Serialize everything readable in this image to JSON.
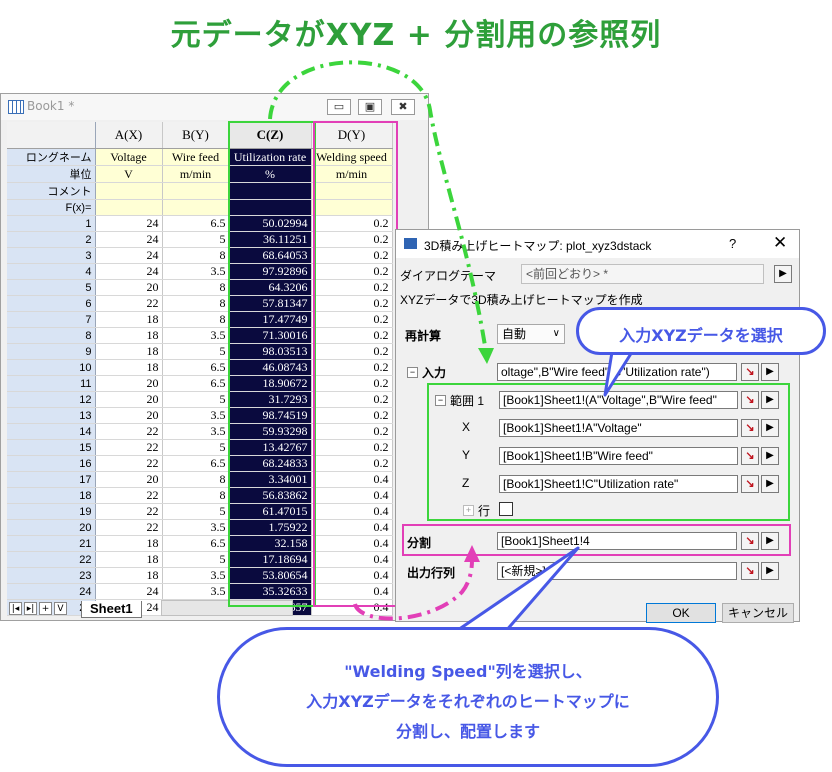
{
  "headline": "元データがXYZ + 分割用の参照列",
  "book": {
    "title": "Book1 *",
    "win_min": "▭",
    "win_max": "▣",
    "win_close": "✖",
    "corner": "",
    "columns": [
      "A(X)",
      "B(Y)",
      "C(Z)",
      "D(Y)"
    ],
    "meta_rows": [
      {
        "label": "ロングネーム",
        "cells": [
          "Voltage",
          "Wire feed",
          "Utilization rate",
          "Welding speed"
        ]
      },
      {
        "label": "単位",
        "cells": [
          "V",
          "m/min",
          "%",
          "m/min"
        ]
      },
      {
        "label": "コメント",
        "cells": [
          "",
          "",
          "",
          ""
        ]
      },
      {
        "label": "F(x)=",
        "cells": [
          "",
          "",
          "",
          ""
        ]
      }
    ],
    "rows": [
      {
        "n": "1",
        "a": "24",
        "b": "6.5",
        "c": "50.02994",
        "d": "0.2"
      },
      {
        "n": "2",
        "a": "24",
        "b": "5",
        "c": "36.11251",
        "d": "0.2"
      },
      {
        "n": "3",
        "a": "24",
        "b": "8",
        "c": "68.64053",
        "d": "0.2"
      },
      {
        "n": "4",
        "a": "24",
        "b": "3.5",
        "c": "97.92896",
        "d": "0.2"
      },
      {
        "n": "5",
        "a": "20",
        "b": "8",
        "c": "64.3206",
        "d": "0.2"
      },
      {
        "n": "6",
        "a": "22",
        "b": "8",
        "c": "57.81347",
        "d": "0.2"
      },
      {
        "n": "7",
        "a": "18",
        "b": "8",
        "c": "17.47749",
        "d": "0.2"
      },
      {
        "n": "8",
        "a": "18",
        "b": "3.5",
        "c": "71.30016",
        "d": "0.2"
      },
      {
        "n": "9",
        "a": "18",
        "b": "5",
        "c": "98.03513",
        "d": "0.2"
      },
      {
        "n": "10",
        "a": "18",
        "b": "6.5",
        "c": "46.08743",
        "d": "0.2"
      },
      {
        "n": "11",
        "a": "20",
        "b": "6.5",
        "c": "18.90672",
        "d": "0.2"
      },
      {
        "n": "12",
        "a": "20",
        "b": "5",
        "c": "31.7293",
        "d": "0.2"
      },
      {
        "n": "13",
        "a": "20",
        "b": "3.5",
        "c": "98.74519",
        "d": "0.2"
      },
      {
        "n": "14",
        "a": "22",
        "b": "3.5",
        "c": "59.93298",
        "d": "0.2"
      },
      {
        "n": "15",
        "a": "22",
        "b": "5",
        "c": "13.42767",
        "d": "0.2"
      },
      {
        "n": "16",
        "a": "22",
        "b": "6.5",
        "c": "68.24833",
        "d": "0.2"
      },
      {
        "n": "17",
        "a": "20",
        "b": "8",
        "c": "3.34001",
        "d": "0.4"
      },
      {
        "n": "18",
        "a": "22",
        "b": "8",
        "c": "56.83862",
        "d": "0.4"
      },
      {
        "n": "19",
        "a": "22",
        "b": "5",
        "c": "61.47015",
        "d": "0.4"
      },
      {
        "n": "20",
        "a": "22",
        "b": "3.5",
        "c": "1.75922",
        "d": "0.4"
      },
      {
        "n": "21",
        "a": "18",
        "b": "6.5",
        "c": "32.158",
        "d": "0.4"
      },
      {
        "n": "22",
        "a": "18",
        "b": "5",
        "c": "17.18694",
        "d": "0.4"
      },
      {
        "n": "23",
        "a": "18",
        "b": "3.5",
        "c": "53.80654",
        "d": "0.4"
      },
      {
        "n": "24",
        "a": "24",
        "b": "3.5",
        "c": "35.32633",
        "d": "0.4"
      },
      {
        "n": "25",
        "a": "24",
        "b": "6.5",
        "c": "89.04657",
        "d": "0.4"
      }
    ],
    "nav_buttons": [
      "|◂",
      "▸|",
      "+",
      "V"
    ],
    "sheet_tab": "Sheet1"
  },
  "dialog": {
    "title": "3D積み上げヒートマップ: plot_xyz3dstack",
    "help": "?",
    "close": "✕",
    "theme_label": "ダイアログテーマ",
    "theme_value": "<前回どおり> *",
    "theme_arrow": "▶",
    "description": "XYZデータで3D積み上げヒートマップを作成",
    "recalc_label": "再計算",
    "recalc_value": "自動",
    "recalc_arrow": "∨",
    "input_label": "入力",
    "input_value": "oltage\",B\"Wire feed\",C\"Utilization rate\")",
    "range_label": "範囲 1",
    "range_value": "[Book1]Sheet1!(A\"Voltage\",B\"Wire feed\"",
    "x_label": "X",
    "x_value": "[Book1]Sheet1!A\"Voltage\"",
    "y_label": "Y",
    "y_value": "[Book1]Sheet1!B\"Wire feed\"",
    "z_label": "Z",
    "z_value": "[Book1]Sheet1!C\"Utilization rate\"",
    "row_label": "行",
    "split_label": "分割",
    "split_value": "[Book1]Sheet1!4",
    "output_label": "出力行列",
    "output_value": "[<新規>]",
    "ok": "OK",
    "cancel": "キャンセル",
    "minus": "−",
    "plus": "+",
    "pick": "↘",
    "arrow": "▶"
  },
  "callouts": {
    "select_xyz": "入力XYZデータを選択",
    "split_line1": "\"Welding Speed\"列を選択し、",
    "split_line2": "入力XYZデータをそれぞれのヒートマップに",
    "split_line3": "分割し、配置します"
  },
  "colors": {
    "headline": "#2e9f3a",
    "green_highlight": "#3cd53c",
    "pink_highlight": "#e23fb7",
    "callout_blue": "#4758e6",
    "selected_column": "#0a0a3e"
  }
}
